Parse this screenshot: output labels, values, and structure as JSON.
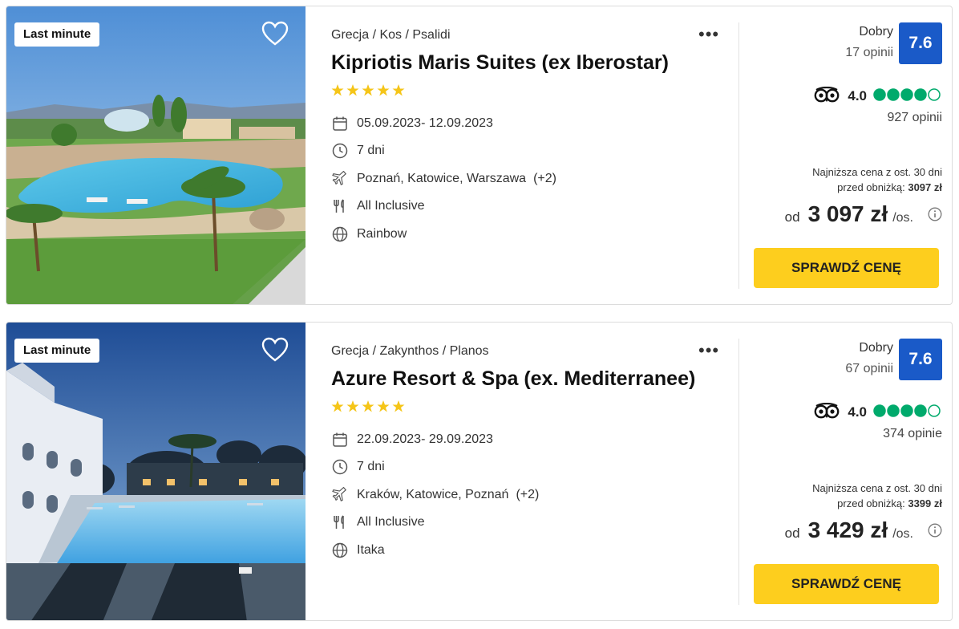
{
  "offers": [
    {
      "badge": "Last minute",
      "location": "Grecja / Kos / Psalidi",
      "name": "Kipriotis Maris Suites (ex Iberostar)",
      "stars": 5,
      "dates": "05.09.2023- 12.09.2023",
      "duration": "7 dni",
      "airports": "Poznań, Katowice, Warszawa",
      "airports_more": "(+2)",
      "board": "All Inclusive",
      "operator": "Rainbow",
      "rating_label": "Dobry",
      "rating_count": "17 opinii",
      "rating_score": "7.6",
      "ta_score": "4.0",
      "ta_bubbles": 4,
      "ta_count": "927 opinii",
      "lowest_line1": "Najniższa cena z ost. 30 dni",
      "lowest_line2": "przed obniżką:",
      "lowest_value": "3097 zł",
      "price_prefix": "od",
      "price": "3 097 zł",
      "price_suffix": "/os.",
      "cta": "SPRAWDŹ CENĘ"
    },
    {
      "badge": "Last minute",
      "location": "Grecja / Zakynthos / Planos",
      "name": "Azure Resort & Spa (ex. Mediterranee)",
      "stars": 5,
      "dates": "22.09.2023- 29.09.2023",
      "duration": "7 dni",
      "airports": "Kraków, Katowice, Poznań",
      "airports_more": "(+2)",
      "board": "All Inclusive",
      "operator": "Itaka",
      "rating_label": "Dobry",
      "rating_count": "67 opinii",
      "rating_score": "7.6",
      "ta_score": "4.0",
      "ta_bubbles": 4,
      "ta_count": "374 opinie",
      "lowest_line1": "Najniższa cena z ost. 30 dni",
      "lowest_line2": "przed obniżką:",
      "lowest_value": "3399 zł",
      "price_prefix": "od",
      "price": "3 429 zł",
      "price_suffix": "/os.",
      "cta": "SPRAWDŹ CENĘ"
    }
  ],
  "colors": {
    "rating_box": "#1a5ac8",
    "cta": "#fdce1e",
    "star": "#f5c518",
    "ta_bubble": "#00aa6c"
  },
  "icons": {
    "calendar": "calendar-icon",
    "clock": "clock-icon",
    "plane": "plane-icon",
    "board": "fork-knife-icon",
    "operator": "globe-icon",
    "favorite": "heart-icon",
    "more": "more-dots-icon",
    "tripadvisor": "tripadvisor-owl-icon",
    "info": "info-icon"
  }
}
